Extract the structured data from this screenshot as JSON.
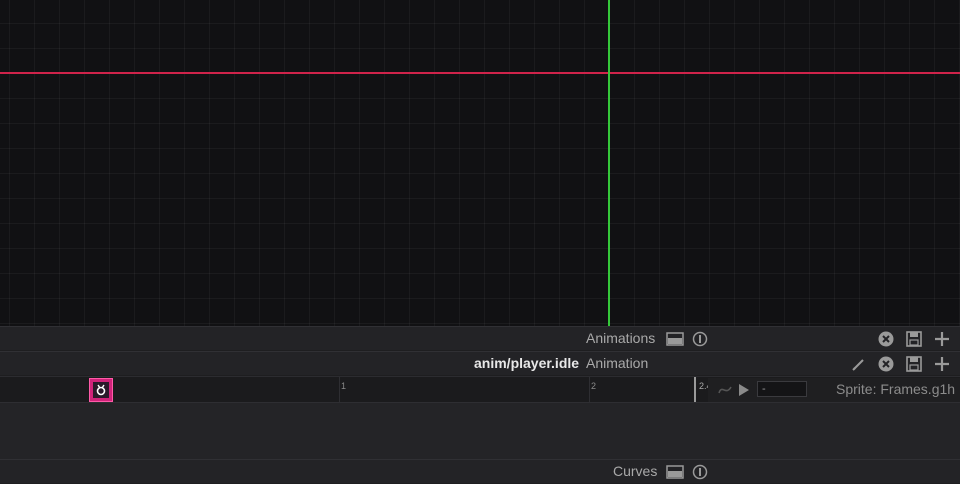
{
  "animations_bar": {
    "title": "Animations",
    "icons": [
      "panel-icon",
      "info-icon",
      "close-icon",
      "save-icon",
      "add-icon"
    ]
  },
  "clip_bar": {
    "clip_name": "anim/player.idle",
    "type_label": "Animation",
    "icons": [
      "edit-icon",
      "close-icon",
      "save-icon",
      "add-icon"
    ]
  },
  "timeline": {
    "tick_labels": [
      "1",
      "2"
    ],
    "playhead_label": "2.4",
    "frame_value": "-",
    "sprite_label": "Sprite: Frames.g1h",
    "icons": [
      "curve-icon",
      "play-icon"
    ]
  },
  "curves_bar": {
    "title": "Curves",
    "icons": [
      "panel-icon",
      "info-icon"
    ]
  },
  "colors": {
    "x_axis": "#d0234a",
    "y_axis": "#35c83a",
    "keyframe": "#d0237a",
    "background": "#111113"
  }
}
